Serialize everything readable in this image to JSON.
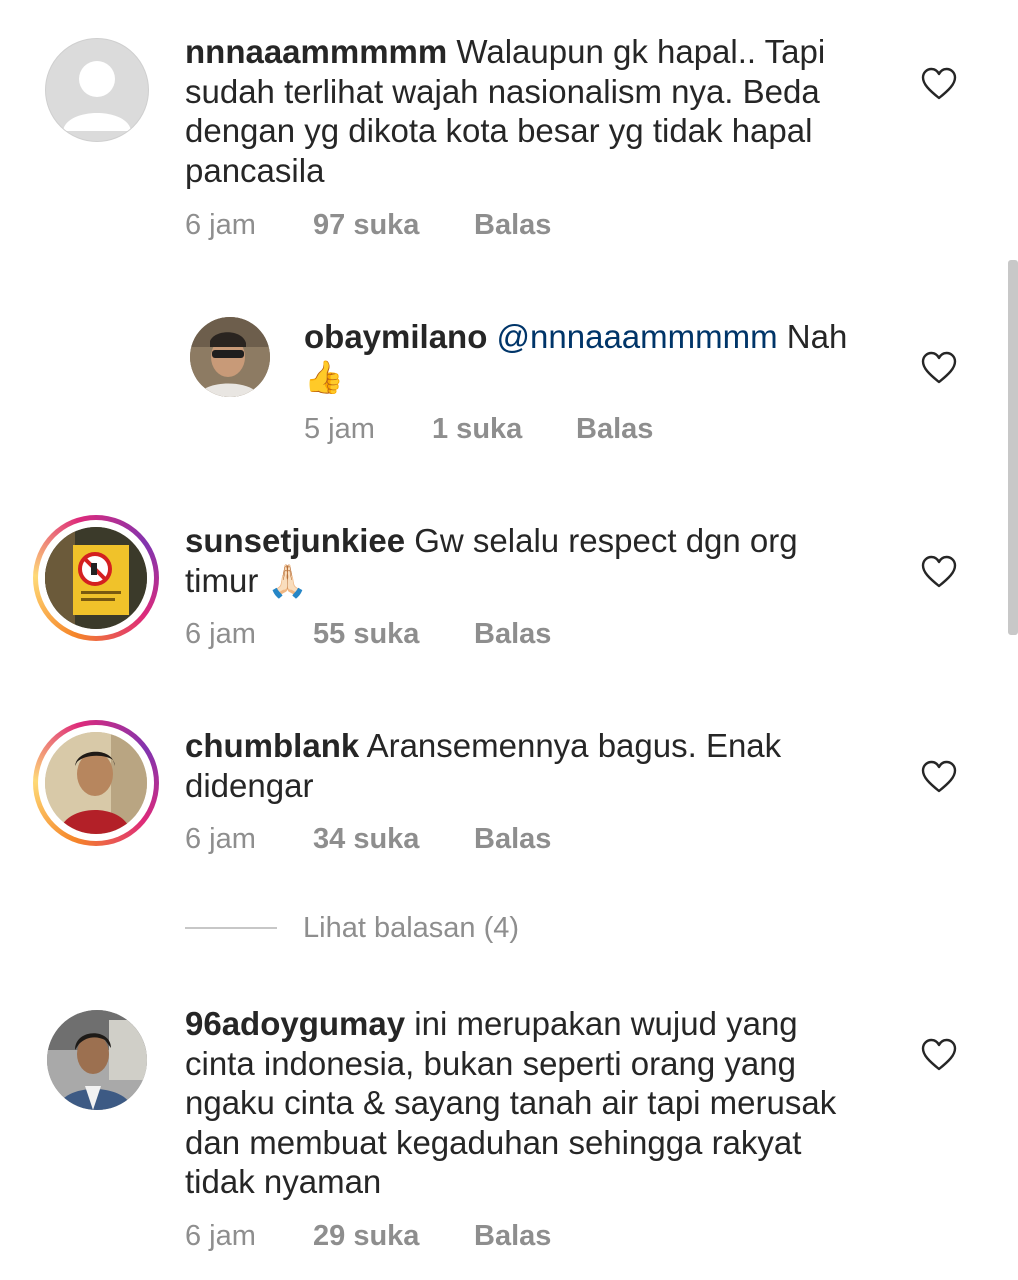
{
  "comments": [
    {
      "username": "nnnaaammmmm",
      "text": "Walaupun gk hapal.. Tapi sudah terlihat wajah nasionalism nya. Beda dengan yg dikota kota besar yg tidak hapal pancasila",
      "time": "6 jam",
      "likes": "97 suka",
      "reply": "Balas",
      "avatar": "default-avatar"
    },
    {
      "username": "obaymilano",
      "mention": "@nnnaaammmmm",
      "text": "Nah",
      "emoji": "👍",
      "time": "5 jam",
      "likes": "1 suka",
      "reply": "Balas",
      "avatar": "photo-avatar"
    },
    {
      "username": "sunsetjunkiee",
      "text": "Gw selalu respect dgn org timur",
      "emoji": "🙏🏻",
      "time": "6 jam",
      "likes": "55 suka",
      "reply": "Balas",
      "avatar": "sign-avatar"
    },
    {
      "username": "chumblank",
      "text": "Aransemennya bagus. Enak didengar",
      "time": "6 jam",
      "likes": "34 suka",
      "reply": "Balas",
      "avatar": "photo-avatar"
    },
    {
      "username": "96adoygumay",
      "text": "ini merupakan wujud yang cinta indonesia, bukan seperti orang yang ngaku cinta & sayang tanah air tapi merusak dan membuat kegaduhan sehingga rakyat tidak nyaman",
      "time": "6 jam",
      "likes": "29 suka",
      "reply": "Balas",
      "avatar": "photo-avatar"
    }
  ],
  "view_replies": "Lihat balasan (4)",
  "colors": {
    "text": "#262626",
    "meta": "#8e8e8e",
    "mention": "#003569",
    "story_ring": [
      "#f58529",
      "#dd2a7b",
      "#8134af"
    ]
  },
  "icons": {
    "like": "heart-outline-icon"
  }
}
